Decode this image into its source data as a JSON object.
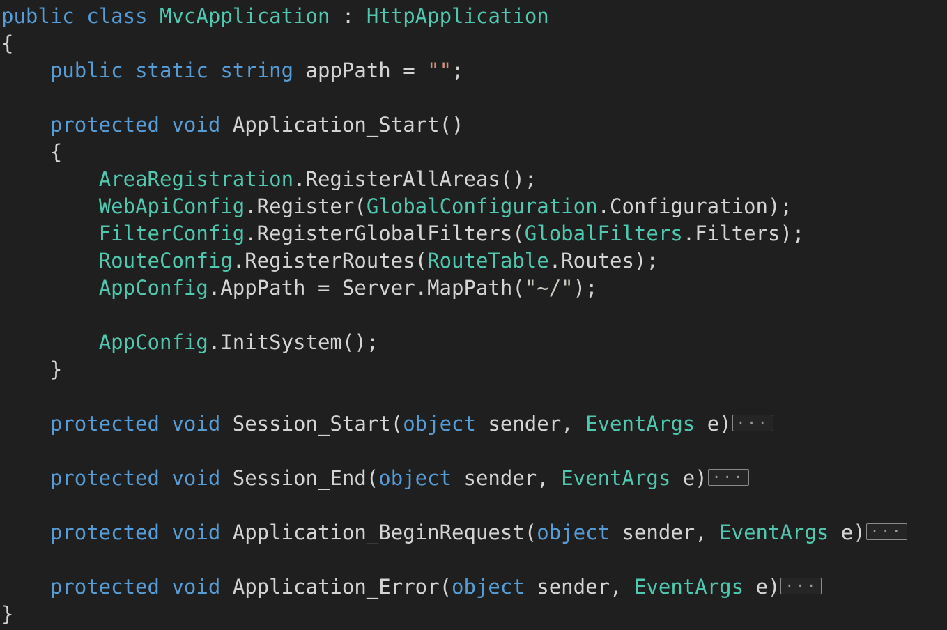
{
  "editor": {
    "language": "csharp",
    "background_color": "#1f1f1f",
    "foreground_color": "#d4d4d4",
    "keyword_color": "#569cd6",
    "type_color": "#4ec9b0",
    "string_color": "#ce9178",
    "fold_marker_label": "...",
    "font_size_px": 29,
    "line_height_px": 39,
    "total_lines": 23
  },
  "code": {
    "lines": [
      {
        "n": 1,
        "text": "public class MvcApplication : HttpApplication"
      },
      {
        "n": 2,
        "text": "{"
      },
      {
        "n": 3,
        "text": "    public static string appPath = \"\";"
      },
      {
        "n": 4,
        "text": ""
      },
      {
        "n": 5,
        "text": "    protected void Application_Start()"
      },
      {
        "n": 6,
        "text": "    {"
      },
      {
        "n": 7,
        "text": "        AreaRegistration.RegisterAllAreas();"
      },
      {
        "n": 8,
        "text": "        WebApiConfig.Register(GlobalConfiguration.Configuration);"
      },
      {
        "n": 9,
        "text": "        FilterConfig.RegisterGlobalFilters(GlobalFilters.Filters);"
      },
      {
        "n": 10,
        "text": "        RouteConfig.RegisterRoutes(RouteTable.Routes);"
      },
      {
        "n": 11,
        "text": "        AppConfig.AppPath = Server.MapPath(\"~/\");"
      },
      {
        "n": 12,
        "text": ""
      },
      {
        "n": 13,
        "text": "        AppConfig.InitSystem();"
      },
      {
        "n": 14,
        "text": "    }"
      },
      {
        "n": 15,
        "text": ""
      },
      {
        "n": 16,
        "text": "    protected void Session_Start(object sender, EventArgs e)..."
      },
      {
        "n": 17,
        "text": ""
      },
      {
        "n": 18,
        "text": "    protected void Session_End(object sender, EventArgs e)..."
      },
      {
        "n": 19,
        "text": ""
      },
      {
        "n": 20,
        "text": "    protected void Application_BeginRequest(object sender, EventArgs e)..."
      },
      {
        "n": 21,
        "text": ""
      },
      {
        "n": 22,
        "text": "    protected void Application_Error(object sender, EventArgs e)..."
      },
      {
        "n": 23,
        "text": "}"
      }
    ],
    "tokens": {
      "l1": [
        "public",
        " ",
        "class",
        " ",
        "MvcApplication",
        " : ",
        "HttpApplication"
      ],
      "l2": [
        "{"
      ],
      "l3": [
        "    ",
        "public",
        " ",
        "static",
        " ",
        "string",
        " appPath = ",
        "\"\"",
        ";"
      ],
      "l5": [
        "    ",
        "protected",
        " ",
        "void",
        " Application_Start()"
      ],
      "l6": [
        "    {"
      ],
      "l7": [
        "        ",
        "AreaRegistration",
        ".RegisterAllAreas();"
      ],
      "l8": [
        "        ",
        "WebApiConfig",
        ".Register(",
        "GlobalConfiguration",
        ".Configuration);"
      ],
      "l9": [
        "        ",
        "FilterConfig",
        ".RegisterGlobalFilters(",
        "GlobalFilters",
        ".Filters);"
      ],
      "l10": [
        "        ",
        "RouteConfig",
        ".RegisterRoutes(",
        "RouteTable",
        ".Routes);"
      ],
      "l11": [
        "        ",
        "AppConfig",
        ".AppPath = Server.MapPath(",
        "\"~/\"",
        ");"
      ],
      "l13": [
        "        ",
        "AppConfig",
        ".InitSystem();"
      ],
      "l14": [
        "    }"
      ],
      "l16": [
        "    ",
        "protected",
        " ",
        "void",
        " Session_Start(",
        "object",
        " sender, ",
        "EventArgs",
        " e)"
      ],
      "l18": [
        "    ",
        "protected",
        " ",
        "void",
        " Session_End(",
        "object",
        " sender, ",
        "EventArgs",
        " e)"
      ],
      "l20": [
        "    ",
        "protected",
        " ",
        "void",
        " Application_BeginRequest(",
        "object",
        " sender, ",
        "EventArgs",
        " e)"
      ],
      "l22": [
        "    ",
        "protected",
        " ",
        "void",
        " Application_Error(",
        "object",
        " sender, ",
        "EventArgs",
        " e)"
      ],
      "l23": [
        "}"
      ]
    },
    "fold_markers": [
      {
        "after_line": 16,
        "label": "..."
      },
      {
        "after_line": 18,
        "label": "..."
      },
      {
        "after_line": 20,
        "label": "..."
      },
      {
        "after_line": 22,
        "label": "..."
      }
    ]
  }
}
